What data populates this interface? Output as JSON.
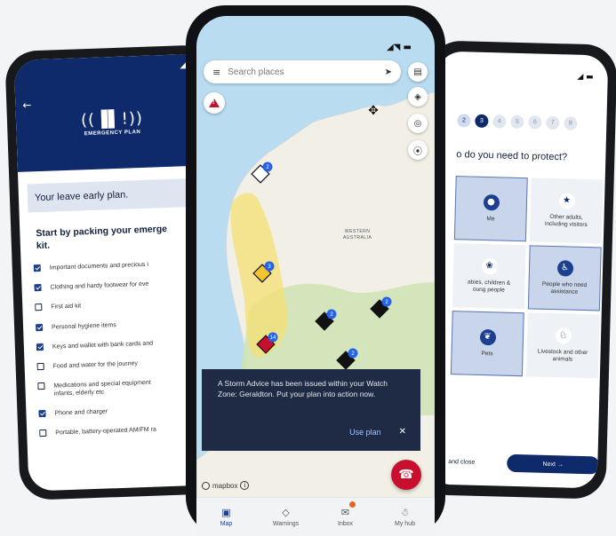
{
  "left_phone": {
    "status_icons": "◢ ◔",
    "back_icon": "←",
    "logo_glyph": "((▐▌!))",
    "logo_title": "EMERGENCY PLAN",
    "plan_box": "Your leave early plan.",
    "heading_line1": "Start by packing your emerge",
    "heading_line2": "kit.",
    "items": [
      {
        "label": "Important documents and precious i",
        "checked": true
      },
      {
        "label": "Clothing and hardy footwear for eve",
        "checked": true
      },
      {
        "label": "First aid kit",
        "checked": false
      },
      {
        "label": "Personal hygiene items",
        "checked": true
      },
      {
        "label": "Keys and wallet with bank cards and",
        "checked": true
      },
      {
        "label": "Food and water for the journey",
        "checked": false
      },
      {
        "label": "Medications and special equipment\ninfants, elderly etc",
        "checked": false
      },
      {
        "label": "Phone and charger",
        "checked": true
      },
      {
        "label": "Portable, battery-operated AM/FM ra",
        "checked": false
      }
    ]
  },
  "center_phone": {
    "status_icons": "◢◥ ▬",
    "search": {
      "placeholder": "Search places",
      "menu_icon": "≡",
      "location_icon": "➤"
    },
    "fab_icons": [
      "▤",
      "◈",
      "◎",
      "⦿"
    ],
    "compass_icon": "✥",
    "map_label": "WESTERN\nAUSTRALIA",
    "incidents": [
      {
        "count": "2",
        "color": "#ffffff"
      },
      {
        "count": "3",
        "color": "#f4c430"
      },
      {
        "count": "14",
        "color": "#c8102e"
      },
      {
        "count": "2",
        "color": "#111111"
      },
      {
        "count": "2",
        "color": "#111111"
      },
      {
        "count": "2",
        "color": "#111111"
      }
    ],
    "toast": {
      "message": "A Storm Advice has been issued within your Watch Zone: Geraldton. Put your plan into action now.",
      "action": "Use plan",
      "close": "✕"
    },
    "call_icon": "☎",
    "mapbox_text": "mapbox",
    "info_icon": "i",
    "tabs": [
      {
        "icon": "▣",
        "label": "Map",
        "active": true
      },
      {
        "icon": "◇",
        "label": "Warnings",
        "active": false
      },
      {
        "icon": "✉",
        "label": "Inbox",
        "active": false
      },
      {
        "icon": "☃",
        "label": "My hub",
        "active": false
      }
    ]
  },
  "right_phone": {
    "status_icons": "◢ ▬",
    "steps": [
      "2",
      "3",
      "4",
      "5",
      "6",
      "7",
      "8"
    ],
    "active_step": "3",
    "question": "o do you need to protect?",
    "tiles": [
      {
        "icon": "●",
        "label": "Me",
        "selected": true
      },
      {
        "icon": "★",
        "label": "Other adults,\nincluding visitors",
        "selected": false
      },
      {
        "icon": "❀",
        "label": "abies, children &\noung people",
        "selected": false
      },
      {
        "icon": "♿",
        "label": "People who need\nassistance",
        "selected": true
      },
      {
        "icon": "❦",
        "label": "Pets",
        "selected": true
      },
      {
        "icon": "♘",
        "label": "Livestock and other\nanimals",
        "selected": false
      }
    ],
    "save_label": "and close",
    "next_label": "Next →"
  },
  "colors": {
    "navy": "#0f2a6b",
    "alert_red": "#c8102e",
    "advice_yellow": "#f4c430",
    "map_water": "#b9dcf1",
    "map_land": "#f2f0e6"
  }
}
